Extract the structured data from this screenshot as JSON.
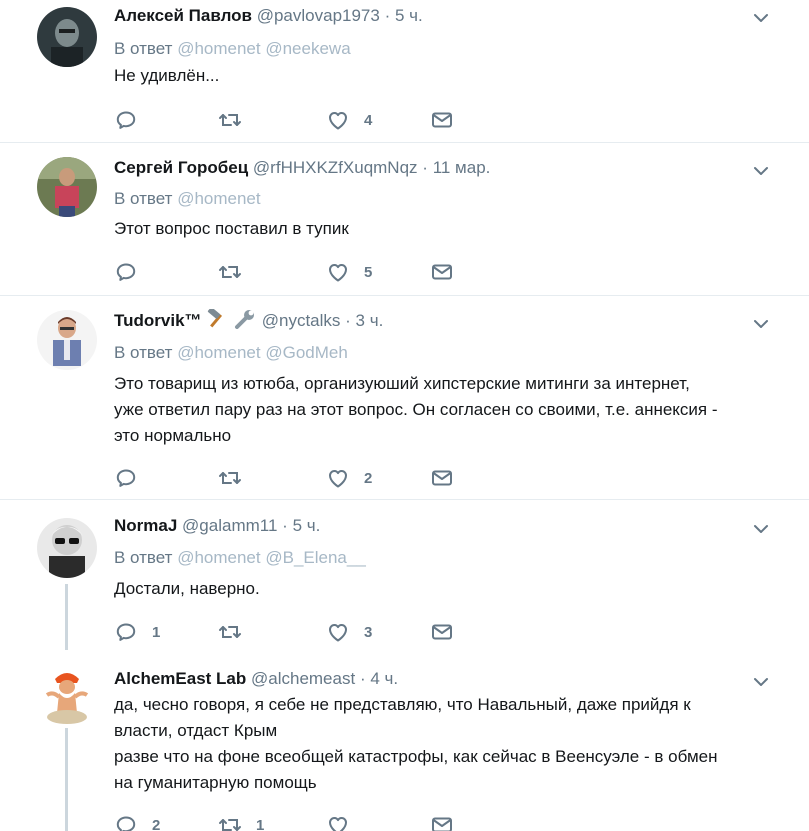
{
  "reply_prefix": "В ответ",
  "tweets": [
    {
      "name": "Алексей Павлов",
      "handle": "@pavlovap1973",
      "time": "5 ч.",
      "mentions": [
        "@homenet",
        "@neekewa"
      ],
      "text": [
        "Не удивлён..."
      ],
      "counts": {
        "reply": "",
        "retweet": "",
        "like": "4"
      }
    },
    {
      "name": "Сергей Горобец",
      "handle": "@rfHHXKZfXuqmNqz",
      "time": "11 мар.",
      "mentions": [
        "@homenet"
      ],
      "text": [
        "Этот вопрос поставил в тупик"
      ],
      "counts": {
        "reply": "",
        "retweet": "",
        "like": "5"
      }
    },
    {
      "name": "Tudorvik™",
      "handle": "@nyctalks",
      "time": "3 ч.",
      "mentions": [
        "@homenet",
        "@GodMeh"
      ],
      "text": [
        "Это товарищ из ютюба, организуюший хипстерские митинги за интернет,",
        "уже ответил пару раз на этот вопрос. Он согласен со своими, т.е. аннексия -",
        "это нормально"
      ],
      "counts": {
        "reply": "",
        "retweet": "",
        "like": "2"
      }
    },
    {
      "name": "NormaJ",
      "handle": "@galamm11",
      "time": "5 ч.",
      "mentions": [
        "@homenet",
        "@B_Elena__"
      ],
      "text": [
        "Достали, наверно."
      ],
      "counts": {
        "reply": "1",
        "retweet": "",
        "like": "3"
      }
    },
    {
      "name": "AlchemEast Lab",
      "handle": "@alchemeast",
      "time": "4 ч.",
      "mentions": [],
      "text": [
        "да, чесно говоря, я себе не представляю, что Навальный, даже прийдя к",
        "власти, отдаст Крым",
        "разве что на фоне всеобщей катастрофы, как сейчас в Веенсуэле - в обмен",
        "на гуманитарную помощь"
      ],
      "counts": {
        "reply": "2",
        "retweet": "1",
        "like": ""
      }
    }
  ],
  "icons": {
    "reply": "reply-icon",
    "retweet": "retweet-icon",
    "like": "heart-icon",
    "dm": "direct-message-icon",
    "more": "chevron-down-icon",
    "tudorvik_emoji": [
      "hammer-icon",
      "wrench-icon"
    ]
  },
  "colors": {
    "icon": "#657786",
    "mention": "#a7b8c6",
    "divider": "#e6ecf0",
    "thread_line": "#ccd6dd"
  }
}
